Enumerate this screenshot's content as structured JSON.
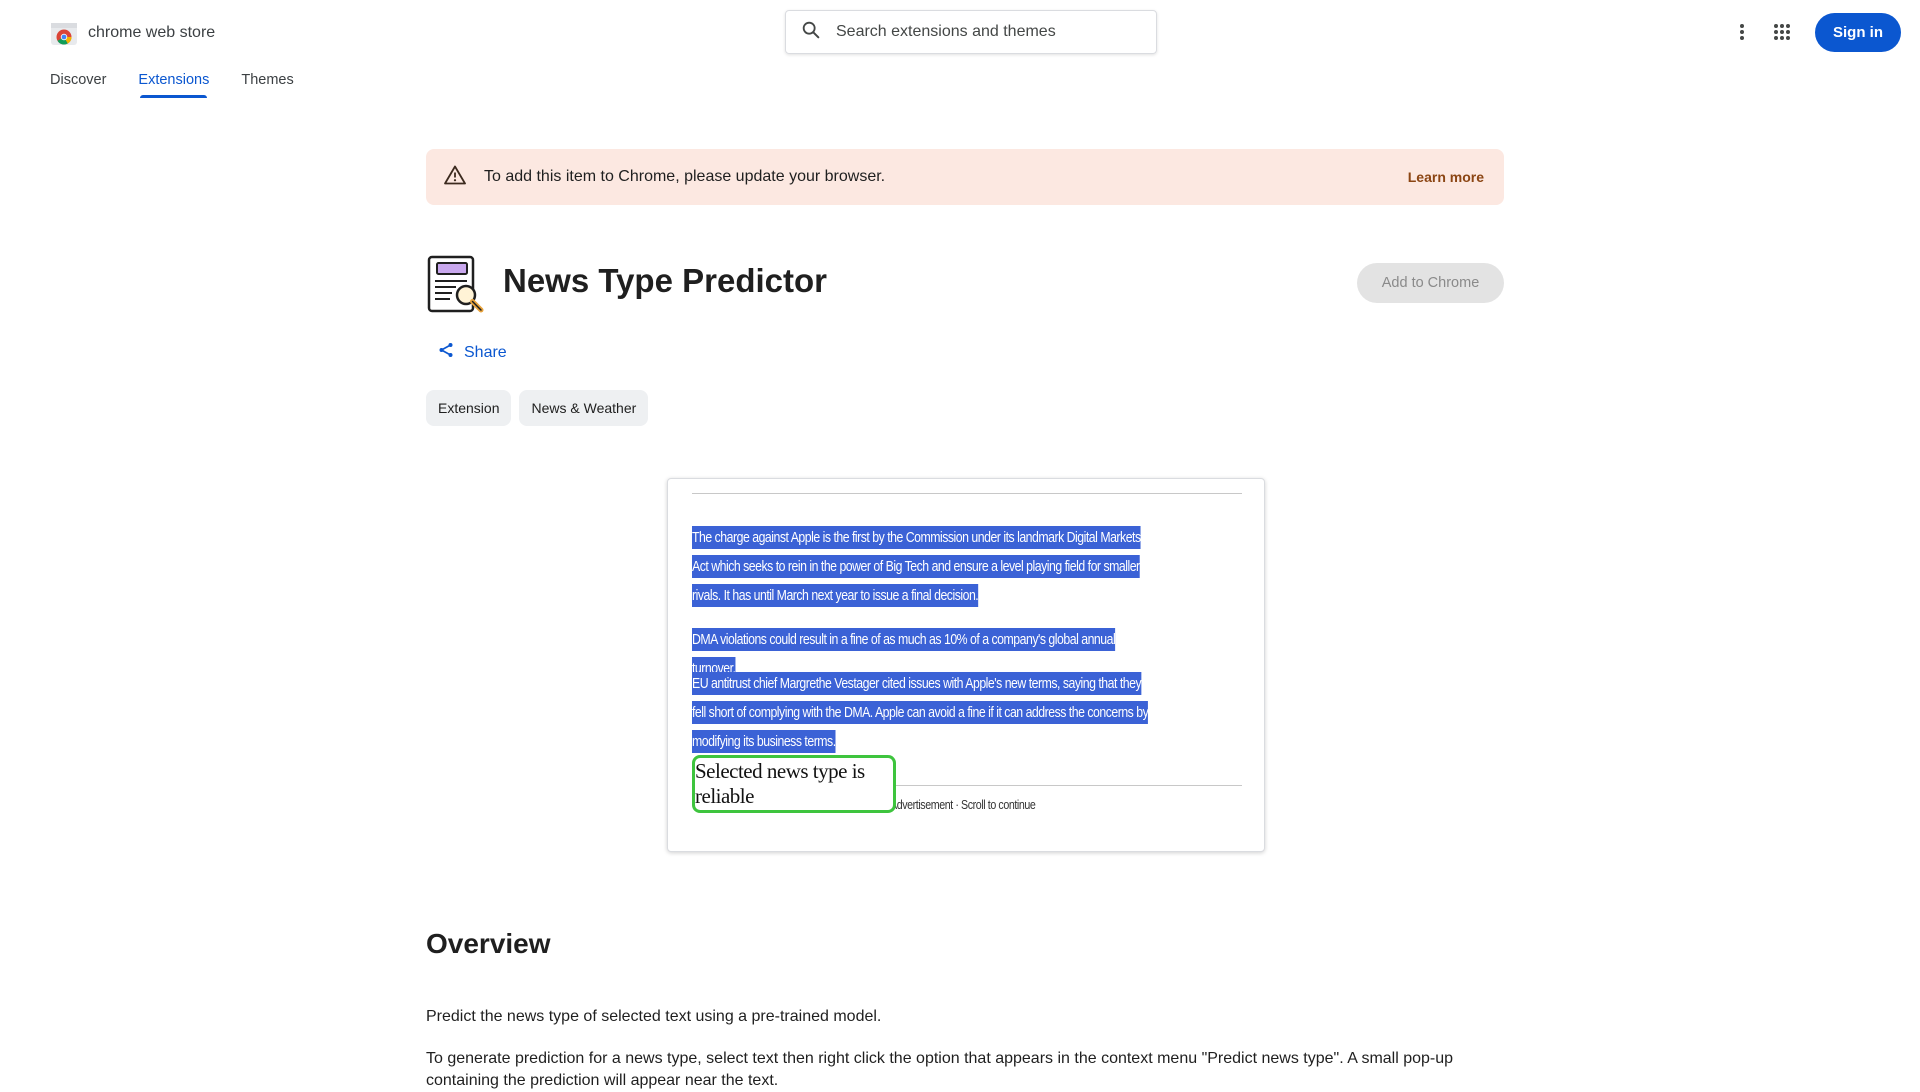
{
  "header": {
    "logo_text": "chrome web store",
    "search_placeholder": "Search extensions and themes",
    "signin_label": "Sign in",
    "icons": [
      "search-icon",
      "more-vert-icon",
      "apps-grid-icon"
    ]
  },
  "nav": {
    "items": [
      {
        "label": "Discover",
        "active": false
      },
      {
        "label": "Extensions",
        "active": true
      },
      {
        "label": "Themes",
        "active": false
      }
    ]
  },
  "banner": {
    "text": "To add this item to Chrome, please update your browser.",
    "link": "Learn more",
    "icon": "warning-icon"
  },
  "extension": {
    "title": "News Type Predictor",
    "add_label": "Add to Chrome",
    "share_label": "Share",
    "chips": [
      "Extension",
      "News & Weather"
    ]
  },
  "screenshot": {
    "paragraphs": [
      "The charge against Apple is the first by the Commission under its landmark Digital Markets Act which seeks to rein in the power of Big Tech and ensure a level playing field for smaller rivals. It has until March next year to issue a final decision.",
      "DMA violations could result in a fine of as much as 10% of a company's global annual turnover.",
      "EU antitrust chief Margrethe Vestager cited issues with Apple's new terms, saying that they fell short of complying with the DMA. Apple can avoid a fine if it can address the concerns by modifying its business terms."
    ],
    "popup": "Selected news type is reliable",
    "ad_text": "Advertisement · Scroll to continue"
  },
  "overview": {
    "heading": "Overview",
    "p1": "Predict the news type of selected text using a pre-trained model.",
    "p2": "To generate prediction for a news type, select text then right click the option that appears in the context menu \"Predict news type\". A small pop-up containing the prediction will appear near the text."
  },
  "colors": {
    "accent": "#0b57d0",
    "banner_bg": "#fce8e1",
    "banner_link": "#8b4513",
    "selection": "#3b62d6",
    "popup_border": "#3ec43e"
  }
}
